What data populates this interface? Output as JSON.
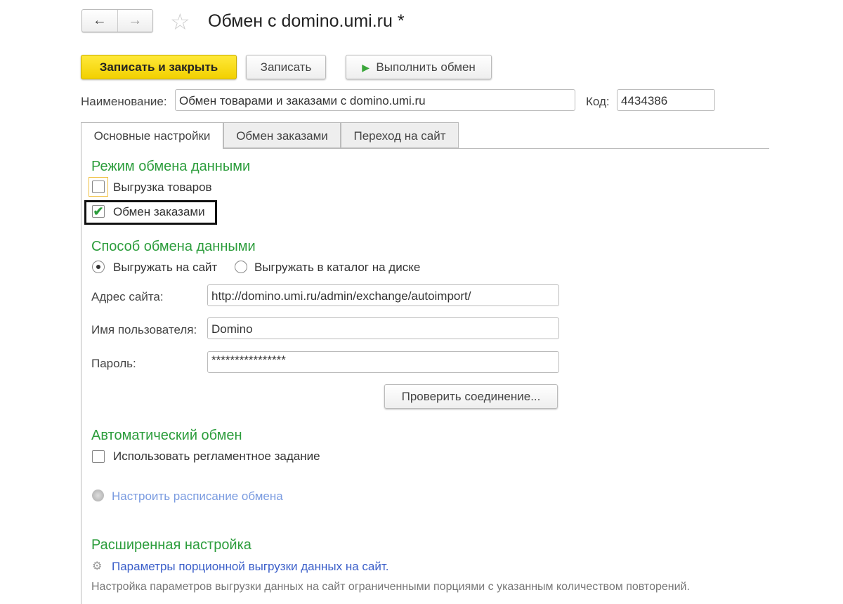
{
  "header": {
    "title": "Обмен с domino.umi.ru *",
    "back": "←",
    "forward": "→"
  },
  "toolbar": {
    "save_close": "Записать и закрыть",
    "save": "Записать",
    "run": "Выполнить обмен"
  },
  "fields": {
    "name_label": "Наименование:",
    "name_value": "Обмен товарами и заказами с domino.umi.ru",
    "code_label": "Код:",
    "code_value": "4434386"
  },
  "tabs": [
    "Основные настройки",
    "Обмен заказами",
    "Переход на сайт"
  ],
  "mode": {
    "title": "Режим обмена данными",
    "export_goods": "Выгрузка товаров",
    "export_goods_checked": false,
    "orders": "Обмен заказами",
    "orders_checked": true
  },
  "method": {
    "title": "Способ обмена данными",
    "opt_site": "Выгружать на сайт",
    "opt_disk": "Выгружать в каталог на диске",
    "selected": "site",
    "address_label": "Адрес сайта:",
    "address_value": "http://domino.umi.ru/admin/exchange/autoimport/",
    "user_label": "Имя пользователя:",
    "user_value": "Domino",
    "pass_label": "Пароль:",
    "pass_value": "****************",
    "check": "Проверить соединение..."
  },
  "auto": {
    "title": "Автоматический обмен",
    "use_task": "Использовать регламентное задание",
    "schedule": "Настроить расписание обмена"
  },
  "advanced": {
    "title": "Расширенная настройка",
    "link": "Параметры порционной выгрузки данных на сайт.",
    "desc": "Настройка параметров выгрузки данных на сайт ограниченными порциями с указанным количеством повторений."
  },
  "colors": {
    "accent_green": "#2c9d3c",
    "yellow": "#f2d000",
    "link": "#3a5ec9"
  }
}
